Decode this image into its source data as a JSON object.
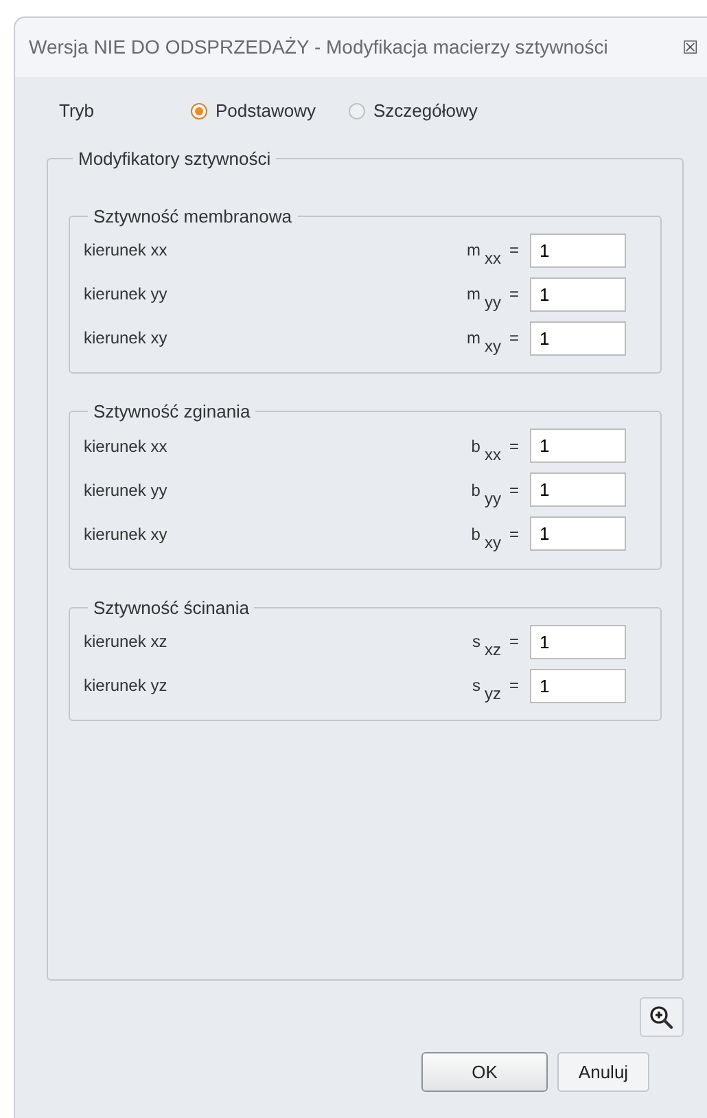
{
  "window": {
    "title": "Wersja NIE DO ODSPRZEDAŻY - Modyfikacja macierzy sztywności",
    "close": "☒"
  },
  "mode": {
    "label": "Tryb",
    "options": [
      {
        "label": "Podstawowy",
        "selected": true
      },
      {
        "label": "Szczegółowy",
        "selected": false
      }
    ]
  },
  "modifiers": {
    "title": "Modyfikatory sztywności",
    "groups": [
      {
        "title": "Sztywność membranowa",
        "rows": [
          {
            "label": "kierunek xx",
            "symbol": "m",
            "subscript": "xx",
            "equals": "=",
            "value": "1"
          },
          {
            "label": "kierunek yy",
            "symbol": "m",
            "subscript": "yy",
            "equals": "=",
            "value": "1"
          },
          {
            "label": "kierunek xy",
            "symbol": "m",
            "subscript": "xy",
            "equals": "=",
            "value": "1"
          }
        ]
      },
      {
        "title": "Sztywność zginania",
        "rows": [
          {
            "label": "kierunek xx",
            "symbol": "b",
            "subscript": "xx",
            "equals": "=",
            "value": "1"
          },
          {
            "label": "kierunek yy",
            "symbol": "b",
            "subscript": "yy",
            "equals": "=",
            "value": "1"
          },
          {
            "label": "kierunek xy",
            "symbol": "b",
            "subscript": "xy",
            "equals": "=",
            "value": "1"
          }
        ]
      },
      {
        "title": "Sztywność ścinania",
        "rows": [
          {
            "label": "kierunek xz",
            "symbol": "s",
            "subscript": "xz",
            "equals": "=",
            "value": "1"
          },
          {
            "label": "kierunek yz",
            "symbol": "s",
            "subscript": "yz",
            "equals": "=",
            "value": "1"
          }
        ]
      }
    ]
  },
  "buttons": [
    {
      "label": "OK",
      "default": true
    },
    {
      "label": "Anuluj",
      "default": false
    }
  ]
}
